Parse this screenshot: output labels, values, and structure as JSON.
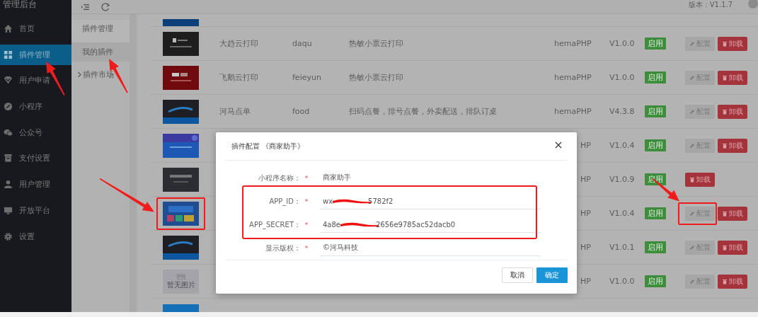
{
  "header": {
    "app_title": "管理后台",
    "version": "版本：V1.1.7"
  },
  "sidebar": {
    "items": [
      {
        "label": "首页",
        "selected": false,
        "arrow": false
      },
      {
        "label": "插件管理",
        "selected": true,
        "arrow": true
      },
      {
        "label": "用户申请",
        "selected": false,
        "arrow": false
      },
      {
        "label": "小程序",
        "selected": false,
        "arrow": false
      },
      {
        "label": "公众号",
        "selected": false,
        "arrow": false
      },
      {
        "label": "支付设置",
        "selected": false,
        "arrow": false
      },
      {
        "label": "用户管理",
        "selected": false,
        "arrow": false
      },
      {
        "label": "开放平台",
        "selected": false,
        "arrow": false
      },
      {
        "label": "设置",
        "selected": false,
        "arrow": false
      }
    ]
  },
  "subnav": {
    "title": "插件管理",
    "items": [
      {
        "label": "我的插件",
        "selected": true,
        "expandable": false,
        "arrow": true
      },
      {
        "label": "插件市场",
        "selected": false,
        "expandable": true,
        "arrow": false
      }
    ]
  },
  "table": {
    "rows": [
      {
        "partial": true,
        "thumbnail": {
          "kind": "picture",
          "marked": false
        }
      },
      {
        "partial": false,
        "thumbnail": {
          "kind": "picture",
          "marked": false
        },
        "name": "大趋云打印",
        "code": "daqu",
        "description": "热敏小票云打印",
        "author": "hemaPHP",
        "version": "V1.0.0",
        "status": "启用",
        "actions": [
          {
            "kind": "edit",
            "label": "配置",
            "marked": false
          },
          {
            "kind": "delete",
            "label": "卸载",
            "marked": false
          }
        ]
      },
      {
        "partial": false,
        "thumbnail": {
          "kind": "picture",
          "marked": false
        },
        "name": "飞鹅云打印",
        "code": "feieyun",
        "description": "热敏小票云打印",
        "author": "hemaPHP",
        "version": "V1.0.0",
        "status": "启用",
        "actions": [
          {
            "kind": "edit",
            "label": "配置",
            "marked": false
          },
          {
            "kind": "delete",
            "label": "卸载",
            "marked": false
          }
        ]
      },
      {
        "partial": false,
        "thumbnail": {
          "kind": "picture",
          "marked": false
        },
        "name": "河马点单",
        "code": "food",
        "description": "扫码点餐，排号点餐，外卖配送，排队订桌",
        "author": "hemaPHP",
        "version": "V4.3.8",
        "status": "启用",
        "actions": [
          {
            "kind": "edit",
            "label": "配置",
            "marked": false
          },
          {
            "kind": "delete",
            "label": "卸载",
            "marked": false
          }
        ]
      },
      {
        "partial": false,
        "thumbnail": {
          "kind": "picture",
          "marked": false
        },
        "author": "HP",
        "version": "V1.0.4",
        "status": "启用",
        "actions": [
          {
            "kind": "edit",
            "label": "配置",
            "marked": false
          },
          {
            "kind": "delete",
            "label": "卸载",
            "marked": false
          }
        ]
      },
      {
        "partial": false,
        "thumbnail": {
          "kind": "picture",
          "marked": false
        },
        "author": "HP",
        "version": "V1.0.9",
        "status": "启用",
        "actions": [
          {
            "kind": "delete",
            "label": "卸载",
            "marked": false
          }
        ]
      },
      {
        "partial": false,
        "thumbnail": {
          "kind": "picture",
          "marked": true
        },
        "author": "HP",
        "version": "V1.0.4",
        "status": "启用",
        "actions": [
          {
            "kind": "edit",
            "label": "配置",
            "marked": true
          },
          {
            "kind": "delete",
            "label": "卸载",
            "marked": false
          }
        ]
      },
      {
        "partial": false,
        "thumbnail": {
          "kind": "picture",
          "marked": false
        },
        "author": "HP",
        "version": "V1.0.1",
        "status": "启用",
        "actions": [
          {
            "kind": "edit",
            "label": "配置",
            "marked": false
          },
          {
            "kind": "delete",
            "label": "卸载",
            "marked": false
          }
        ]
      },
      {
        "partial": false,
        "thumbnail": {
          "kind": "placeholder",
          "label": "暂无图片",
          "marked": false
        },
        "author": "HP",
        "version": "V1.0.0",
        "status": "启用",
        "actions": [
          {
            "kind": "edit",
            "label": "配置",
            "marked": false
          },
          {
            "kind": "delete",
            "label": "卸载",
            "marked": false
          }
        ]
      },
      {
        "partial": true,
        "thumbnail": {
          "kind": "picture",
          "marked": false
        }
      }
    ]
  },
  "modal": {
    "title": "插件配置 《商家助手》",
    "fields": [
      {
        "label": "小程序名称：",
        "required_mark": "*",
        "circled": false,
        "redacted": false,
        "value": "商家助手"
      },
      {
        "label": "APP_ID：",
        "required_mark": "*",
        "circled": true,
        "redacted": true,
        "value": "wx",
        "value_end": "5782f2"
      },
      {
        "label": "APP_SECRET：",
        "required_mark": "*",
        "circled": true,
        "redacted": true,
        "value": "4a8e",
        "value_end": "2656e9785ac52dacb0"
      },
      {
        "label": "显示版权：",
        "required_mark": "*",
        "circled": false,
        "redacted": false,
        "value": "©河马科技"
      }
    ],
    "buttons": [
      {
        "kind": "secondary",
        "label": "取消"
      },
      {
        "kind": "primary",
        "label": "确定"
      }
    ]
  }
}
